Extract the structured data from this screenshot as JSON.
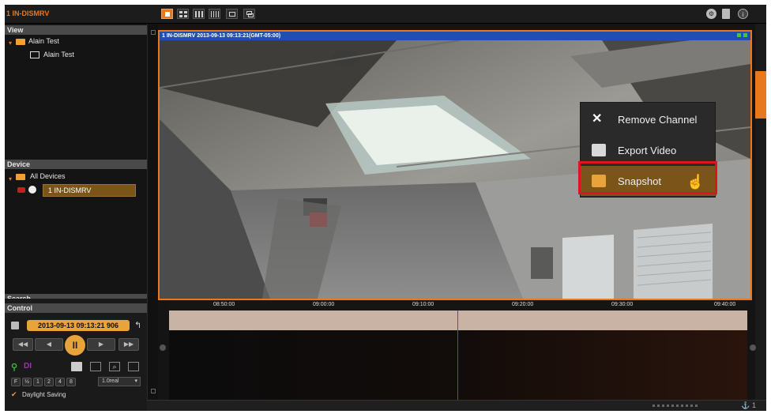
{
  "app": {
    "title": "1 IN-DISMRV"
  },
  "toolbar": {
    "layouts": [
      "layout-1x1",
      "layout-2x2",
      "layout-3x3",
      "layout-4x4",
      "layout-custom",
      "layout-popout"
    ],
    "right_icons": [
      "settings-icon",
      "document-icon",
      "info-icon"
    ]
  },
  "view_panel": {
    "header": "View",
    "group": "Alain Test",
    "item": "Alain Test"
  },
  "device_panel": {
    "header": "Device",
    "group": "All Devices",
    "device": "1 IN-DISMRV"
  },
  "search_panel": {
    "header": "Search"
  },
  "control_panel": {
    "header": "Control",
    "datetime": "2013-09-13 09:13:21 906",
    "buttons": {
      "rewind": "◀◀",
      "step_back": "◀",
      "pause": "II",
      "step_forward": "▶",
      "fast_forward": "▶▶"
    },
    "speeds": [
      "F",
      "½",
      "1",
      "2",
      "4",
      "8"
    ],
    "speed_select": "1.0real",
    "daylight_saving_label": "Daylight Saving",
    "daylight_saving_checked": true
  },
  "video": {
    "overlay_text": "1 IN-DISMRV  2013-09-13 09:13:21(GMT-05:00)"
  },
  "context_menu": {
    "items": [
      {
        "label": "Remove Channel",
        "icon": "close-icon"
      },
      {
        "label": "Export Video",
        "icon": "export-video-icon"
      },
      {
        "label": "Snapshot",
        "icon": "snapshot-icon"
      }
    ],
    "highlighted": "Snapshot"
  },
  "timeline": {
    "ticks": [
      "08:50:00",
      "09:00:00",
      "09:10:00",
      "09:20:00",
      "09:30:00",
      "09:40:00"
    ]
  },
  "status": {
    "right_text": "1"
  },
  "colors": {
    "accent": "#e8781e",
    "highlight_border": "#e0141e",
    "menu_bg": "#2a2a2a",
    "menu_selected": "#7a5418",
    "video_bar": "#1f4fb0"
  }
}
